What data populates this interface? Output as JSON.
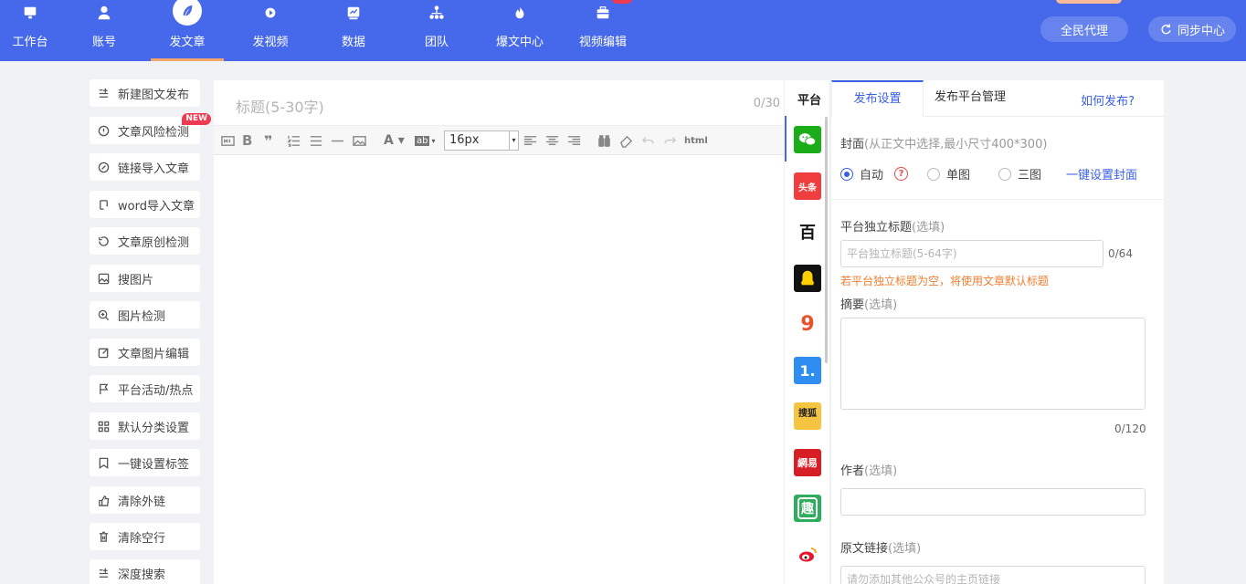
{
  "nav": {
    "items": [
      {
        "label": "工作台",
        "icon": "monitor-icon"
      },
      {
        "label": "账号",
        "icon": "user-icon"
      },
      {
        "label": "发文章",
        "icon": "quill-icon",
        "active": true
      },
      {
        "label": "发视频",
        "icon": "video-icon"
      },
      {
        "label": "数据",
        "icon": "chart-icon"
      },
      {
        "label": "团队",
        "icon": "team-icon"
      },
      {
        "label": "爆文中心",
        "icon": "fire-icon"
      },
      {
        "label": "视频编辑",
        "icon": "toolbox-icon"
      }
    ],
    "agent_button": "全民代理",
    "sync_button": "同步中心"
  },
  "tools": {
    "items": [
      {
        "label": "新建图文发布",
        "icon": "new-list-icon"
      },
      {
        "label": "文章风险检测",
        "icon": "risk-check-icon",
        "badge": "NEW"
      },
      {
        "label": "链接导入文章",
        "icon": "link-icon"
      },
      {
        "label": "word导入文章",
        "icon": "word-import-icon"
      },
      {
        "label": "文章原创检测",
        "icon": "original-check-icon"
      },
      {
        "label": "搜图片",
        "icon": "image-search-icon"
      },
      {
        "label": "图片检测",
        "icon": "zoom-icon"
      },
      {
        "label": "文章图片编辑",
        "icon": "edit-icon"
      },
      {
        "label": "平台活动/热点",
        "icon": "flag-icon"
      },
      {
        "label": "默认分类设置",
        "icon": "grid-icon"
      },
      {
        "label": "一键设置标签",
        "icon": "bookmark-icon"
      },
      {
        "label": "清除外链",
        "icon": "thumb-icon"
      },
      {
        "label": "清除空行",
        "icon": "trash-icon"
      },
      {
        "label": "深度搜索",
        "icon": "deep-search-icon"
      }
    ]
  },
  "editor": {
    "title_placeholder": "标题(5-30字)",
    "title_count": "0/30",
    "font_size": "16px",
    "html_label": "html"
  },
  "platforms": {
    "header": "平台",
    "items": [
      {
        "name": "wechat",
        "color": "#1aad19",
        "text": ""
      },
      {
        "name": "toutiao",
        "color": "#f03d3d",
        "text": "头条"
      },
      {
        "name": "baijiahao",
        "color": "#ffffff",
        "text": "百"
      },
      {
        "name": "qq",
        "color": "#111111",
        "text": ""
      },
      {
        "name": "sohu-yidian",
        "color": "#ffffff",
        "text": "9"
      },
      {
        "name": "yidian",
        "color": "#2e8df0",
        "text": "1."
      },
      {
        "name": "sohu",
        "color": "#f5c542",
        "text": "搜狐"
      },
      {
        "name": "netease",
        "color": "#d81e25",
        "text": "網易"
      },
      {
        "name": "qutoutiao",
        "color": "#2eae5c",
        "text": "趣"
      },
      {
        "name": "weibo",
        "color": "#f5a623",
        "text": ""
      }
    ]
  },
  "settings": {
    "tabs": [
      "发布设置",
      "发布平台管理"
    ],
    "how_to": "如何发布?",
    "cover_label": "封面",
    "cover_hint": "(从正文中选择,最小尺寸400*300)",
    "cover_options": [
      "自动",
      "单图",
      "三图"
    ],
    "cover_selected": "自动",
    "cover_help": "?",
    "cover_link": "一键设置封面",
    "title_label": "平台独立标题",
    "title_optional": "(选填)",
    "title_placeholder": "平台独立标题(5-64字)",
    "title_count": "0/64",
    "title_warning": "若平台独立标题为空，将使用文章默认标题",
    "summary_label": "摘要",
    "summary_optional": "(选填)",
    "summary_count": "0/120",
    "author_label": "作者",
    "author_optional": "(选填)",
    "source_label": "原文链接",
    "source_optional": "(选填)",
    "source_placeholder": "请勿添加其他公众号的主页链接"
  }
}
